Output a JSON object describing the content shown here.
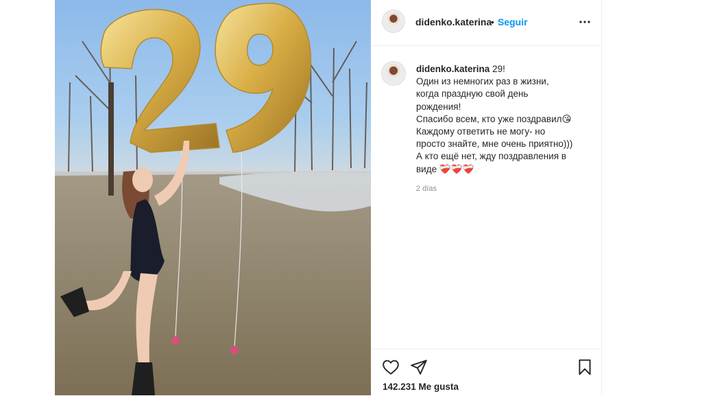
{
  "post": {
    "username": "didenko.katerina",
    "separator": "•",
    "follow_label": "Seguir",
    "more_icon": "more-horizontal-icon",
    "caption": {
      "username": "didenko.katerina",
      "lines": [
        "29!",
        "Один из немногих раз в жизни,",
        "когда праздную свой день",
        "рождения!",
        "Спасибо всем, кто уже поздравил😘",
        "Каждому ответить не могу- но",
        "просто знайте, мне очень приятно)))",
        "А кто ещё нет, жду поздравления в",
        "виде ❤️‍🩹❤️‍🩹❤️‍🩹"
      ]
    },
    "time": "2 días",
    "likes": "142.231 Me gusta",
    "icons": {
      "like": "heart-icon",
      "share": "paper-plane-icon",
      "save": "bookmark-icon"
    }
  },
  "photo": {
    "balloon_text": "29",
    "colors": {
      "sky": "#8cb9ea",
      "balloon": "#d9b04a",
      "grass": "#8a7f64",
      "swimsuit": "#1a1d2b"
    }
  }
}
